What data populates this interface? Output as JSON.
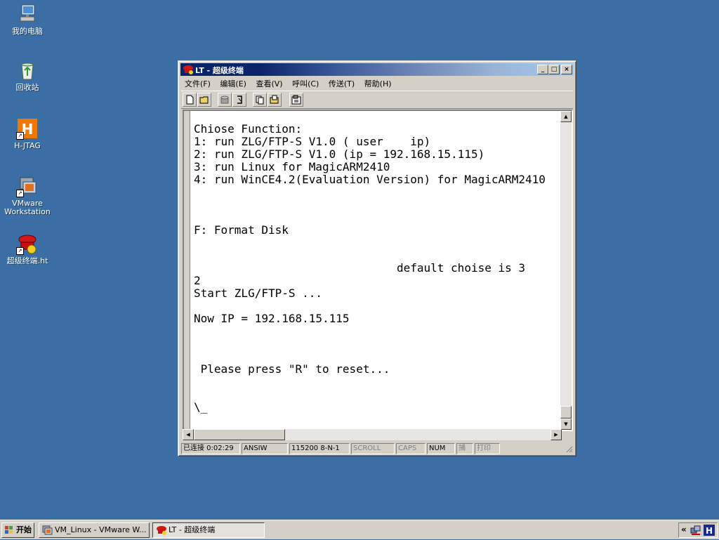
{
  "desktop": {
    "icons": [
      {
        "label": "我的电脑",
        "icon": "my-computer-icon"
      },
      {
        "label": "回收站",
        "icon": "recycle-bin-icon"
      },
      {
        "label": "H-JTAG",
        "icon": "hjtag-icon"
      },
      {
        "label": "VMware Workstation",
        "icon": "vmware-icon"
      },
      {
        "label": "超级终端.ht",
        "icon": "hyperterminal-icon"
      }
    ]
  },
  "window": {
    "title": "LT - 超级终端",
    "menu": [
      "文件(F)",
      "编辑(E)",
      "查看(V)",
      "呼叫(C)",
      "传送(T)",
      "帮助(H)"
    ],
    "toolbar_icons": [
      "new-icon",
      "open-icon",
      "dial-icon",
      "disconnect-icon",
      "send-icon",
      "receive-icon",
      "properties-icon"
    ],
    "terminal_lines": [
      "Chiose Function:",
      "1: run ZLG/FTP-S V1.0 ( user    ip)",
      "2: run ZLG/FTP-S V1.0 (ip = 192.168.15.115)",
      "3: run Linux for MagicARM2410",
      "4: run WinCE4.2(Evaluation Version) for MagicARM2410",
      "",
      "",
      "",
      "F: Format Disk",
      "",
      "",
      "                              default choise is 3",
      "2",
      "Start ZLG/FTP-S ...",
      "",
      "Now IP = 192.168.15.115",
      "",
      "",
      "",
      " Please press \"R\" to reset...",
      "",
      "",
      "\\_"
    ],
    "status": {
      "connected": "已连接 0:02:29",
      "emulation": "ANSIW",
      "port": "115200 8-N-1",
      "scroll": "SCROLL",
      "caps": "CAPS",
      "num": "NUM",
      "capture": "捕",
      "print": "打印"
    }
  },
  "taskbar": {
    "start": "开始",
    "tasks": [
      {
        "label": "VM_Linux - VMware W...",
        "icon": "vmware-icon",
        "active": false
      },
      {
        "label": "LT - 超级终端",
        "icon": "hyperterminal-icon",
        "active": true
      }
    ],
    "tray_chevron": "«",
    "tray_icons": [
      "network-icon",
      "hjtag-tray-icon"
    ]
  }
}
